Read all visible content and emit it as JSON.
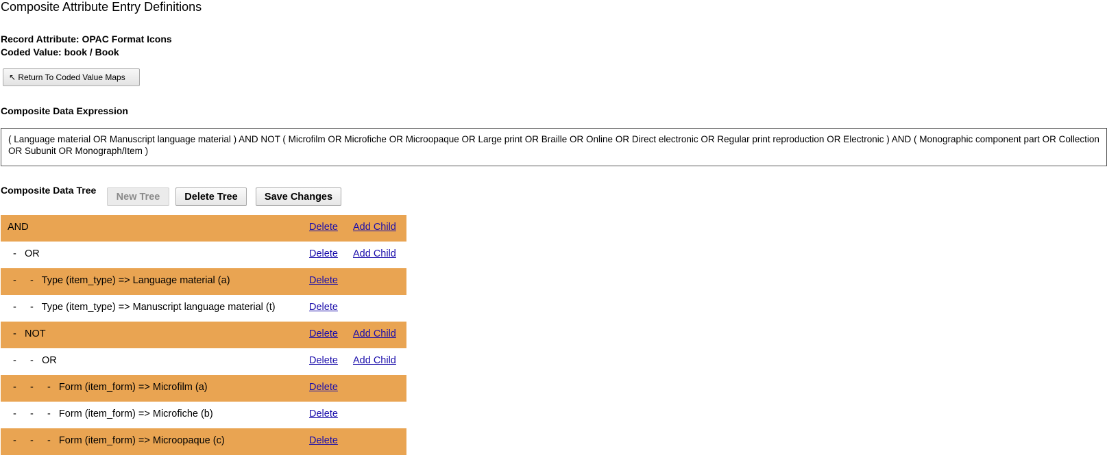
{
  "page": {
    "title": "Composite Attribute Entry Definitions",
    "record_attribute": "Record Attribute: OPAC Format Icons",
    "coded_value": "Coded Value: book / Book",
    "return_button": "↖ Return To Coded Value Maps"
  },
  "expression": {
    "label": "Composite Data Expression",
    "text": "( Language material OR Manuscript language material ) AND NOT ( Microfilm OR Microfiche OR Microopaque OR Large print OR Braille OR Online OR Direct electronic OR Regular print reproduction OR Electronic ) AND ( Monographic component part OR Collection OR Subunit OR Monograph/Item )"
  },
  "tree": {
    "label": "Composite Data Tree",
    "new_tree": "New Tree",
    "delete_tree": "Delete Tree",
    "save_changes": "Save Changes",
    "delete_label": "Delete",
    "add_child_label": "Add Child",
    "rows": [
      {
        "text": "AND",
        "add_child": true
      },
      {
        "text": "  -   OR",
        "add_child": true
      },
      {
        "text": "  -     -   Type (item_type) => Language material (a)",
        "add_child": false
      },
      {
        "text": "  -     -   Type (item_type) => Manuscript language material (t)",
        "add_child": false
      },
      {
        "text": "  -   NOT",
        "add_child": true
      },
      {
        "text": "  -     -   OR",
        "add_child": true
      },
      {
        "text": "  -     -     -   Form (item_form) => Microfilm (a)",
        "add_child": false
      },
      {
        "text": "  -     -     -   Form (item_form) => Microfiche (b)",
        "add_child": false
      },
      {
        "text": "  -     -     -   Form (item_form) => Microopaque (c)",
        "add_child": false
      }
    ]
  },
  "colors": {
    "row_highlight": "#e9a452",
    "link": "#1a0dab"
  }
}
